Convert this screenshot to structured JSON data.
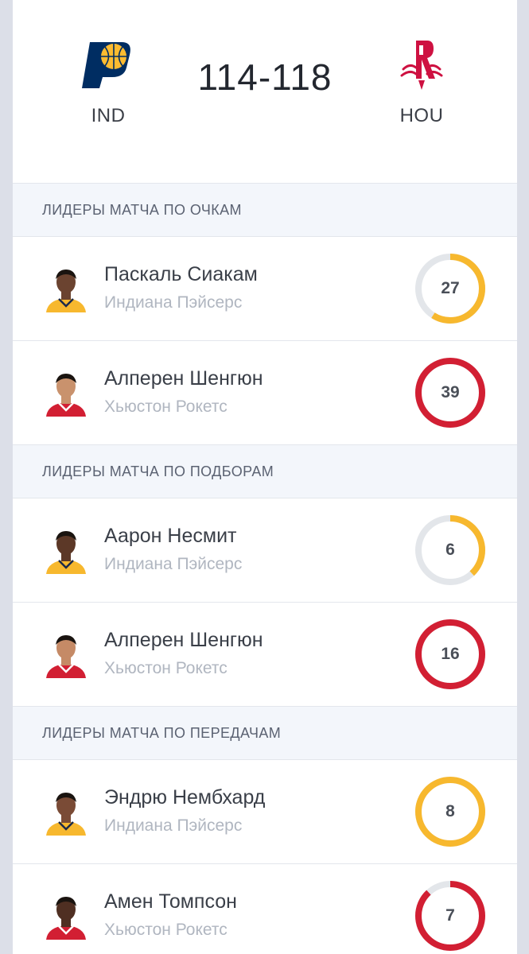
{
  "game": {
    "home": {
      "abbr": "IND",
      "logo_icon": "pacers-logo-icon",
      "color": "#fdbb30",
      "navy": "#002d62"
    },
    "away": {
      "abbr": "HOU",
      "logo_icon": "rockets-logo-icon",
      "color": "#ce1141"
    },
    "score": "114-118"
  },
  "colors": {
    "track": "#e3e6ea",
    "ind": "#f7b82e",
    "hou": "#d21f33"
  },
  "sections": [
    {
      "title": "ЛИДЕРЫ МАТЧА ПО ОЧКАМ",
      "players": [
        {
          "name": "Паскаль Сиакам",
          "team": "Индиана Пэйсерс",
          "team_code": "IND",
          "value": "27",
          "fill": 0.59
        },
        {
          "name": "Алперен Шенгюн",
          "team": "Хьюстон Рокетс",
          "team_code": "HOU",
          "value": "39",
          "fill": 1.0
        }
      ]
    },
    {
      "title": "ЛИДЕРЫ МАТЧА ПО ПОДБОРАМ",
      "players": [
        {
          "name": "Аарон Несмит",
          "team": "Индиана Пэйсерс",
          "team_code": "IND",
          "value": "6",
          "fill": 0.38
        },
        {
          "name": "Алперен Шенгюн",
          "team": "Хьюстон Рокетс",
          "team_code": "HOU",
          "value": "16",
          "fill": 1.0
        }
      ]
    },
    {
      "title": "ЛИДЕРЫ МАТЧА ПО ПЕРЕДАЧАМ",
      "players": [
        {
          "name": "Эндрю Нембхард",
          "team": "Индиана Пэйсерс",
          "team_code": "IND",
          "value": "8",
          "fill": 1.0
        },
        {
          "name": "Амен Томпсон",
          "team": "Хьюстон Рокетс",
          "team_code": "HOU",
          "value": "7",
          "fill": 0.88
        }
      ]
    }
  ]
}
